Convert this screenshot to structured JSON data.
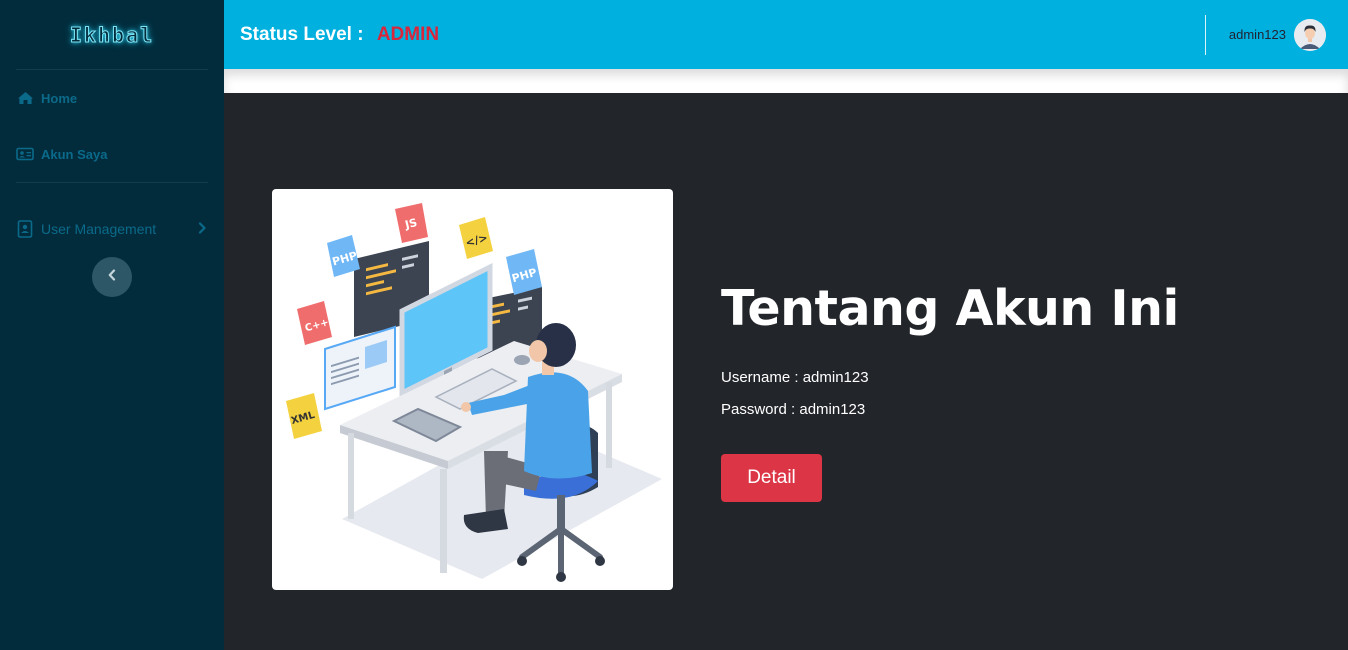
{
  "brand": {
    "name": "Ikhbal"
  },
  "sidebar": {
    "items": [
      {
        "label": "Home",
        "icon": "home-icon"
      },
      {
        "label": "Akun Saya",
        "icon": "id-card-icon"
      },
      {
        "label": "User Management",
        "icon": "address-book-icon"
      }
    ],
    "toggle_icon": "chevron-left-icon"
  },
  "topbar": {
    "status_label": "Status Level :",
    "status_value": "ADMIN",
    "username": "admin123",
    "avatar_icon": "user-avatar-icon"
  },
  "main": {
    "title": "Tentang Akun Ini",
    "username_line": "Username : admin123",
    "password_line": "Password : admin123",
    "detail_button": "Detail",
    "illustration": {
      "badges": [
        "PHP",
        "JS",
        "</>",
        "PHP",
        "C++",
        "XML"
      ]
    }
  },
  "colors": {
    "sidebar_bg": "#022c3c",
    "topbar_bg": "#00b1e0",
    "content_bg": "#22252a",
    "admin_red": "#d9263c",
    "button_red": "#dc3545",
    "nav_text": "#0b6a8a"
  }
}
